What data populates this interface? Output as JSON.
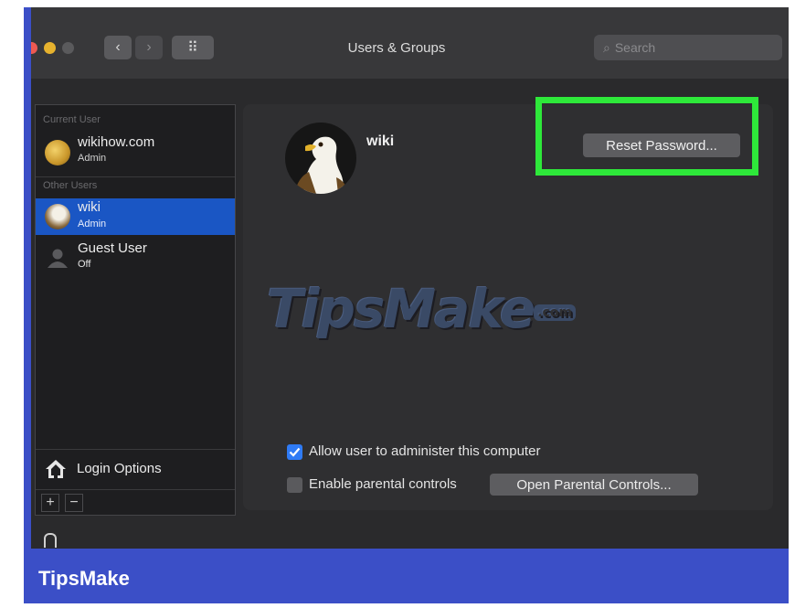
{
  "window": {
    "title": "Users & Groups",
    "search_placeholder": "Search",
    "nav_back_icon": "‹",
    "nav_forward_icon": "›",
    "grid_icon": "⠿"
  },
  "sidebar": {
    "current_user_header": "Current User",
    "current_user": {
      "name": "wikihow.com",
      "role": "Admin"
    },
    "other_users_header": "Other Users",
    "other_users": [
      {
        "name": "wiki",
        "role": "Admin",
        "selected": true
      },
      {
        "name": "Guest User",
        "role": "Off",
        "selected": false
      }
    ],
    "login_options_label": "Login Options",
    "add_label": "+",
    "remove_label": "−"
  },
  "main": {
    "user_name": "wiki",
    "reset_password_label": "Reset Password...",
    "allow_admin_label": "Allow user to administer this computer",
    "allow_admin_checked": true,
    "parental_label": "Enable parental controls",
    "parental_checked": false,
    "open_parental_label": "Open Parental Controls..."
  },
  "watermark": {
    "main": "TipsMake",
    "suffix": ".com"
  },
  "footer": {
    "brand": "TipsMake"
  },
  "colors": {
    "frame": "#3b4fc7",
    "selection": "#1a56c4",
    "highlight": "#2ee83a",
    "checkbox_checked": "#2f7bf5"
  }
}
